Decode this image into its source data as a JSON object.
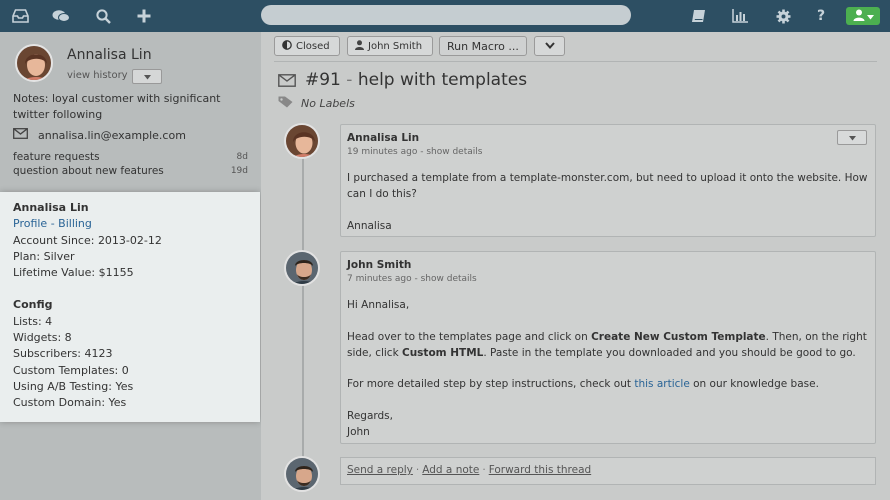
{
  "nav": {
    "icons": [
      "inbox-icon",
      "chat-icon",
      "search-icon",
      "plus-icon",
      "book-icon",
      "bar-chart-icon",
      "gear-icon",
      "help-icon",
      "user-icon"
    ]
  },
  "customer": {
    "name": "Annalisa Lin",
    "view_history": "view history",
    "notes": "Notes: loyal customer with significant twitter following",
    "email": "annalisa.lin@example.com",
    "conversations": [
      {
        "subject": "feature requests",
        "age": "8d"
      },
      {
        "subject": "question about new features",
        "age": "19d"
      }
    ]
  },
  "profile": {
    "name": "Annalisa Lin",
    "link": "Profile - Billing",
    "account_since": "Account Since: 2013-02-12",
    "plan": "Plan: Silver",
    "lifetime_value": "Lifetime Value: $1155",
    "config_heading": "Config",
    "config": [
      "Lists: 4",
      "Widgets: 8",
      "Subscribers: 4123",
      "Custom Templates: 0",
      "Using A/B Testing: Yes",
      "Custom Domain: Yes"
    ]
  },
  "toolbar": {
    "status": "Closed",
    "assignee": "John Smith",
    "macro": "Run Macro ..."
  },
  "ticket": {
    "number": "#91",
    "separator": " - ",
    "subject": "help with templates",
    "labels": "No Labels"
  },
  "messages": [
    {
      "author": "Annalisa Lin",
      "time": "19 minutes ago",
      "details": "show details",
      "body": [
        "I purchased a template from a template-monster.com, but need to upload it onto the website.  How can I do this?",
        "Annalisa"
      ]
    },
    {
      "author": "John Smith",
      "time": "7 minutes ago",
      "details": "show details",
      "greeting": "Hi Annalisa,",
      "p1_a": "Head over to the templates page and click on ",
      "p1_b": "Create New Custom Template",
      "p1_c": ". Then, on the right side, click ",
      "p1_d": "Custom HTML",
      "p1_e": ". Paste in the template you downloaded and you should be good to go.",
      "p2_a": "For more detailed step by step instructions, check out ",
      "p2_link": "this article",
      "p2_b": " on our knowledge base.",
      "signoff": "Regards,",
      "signature": "John"
    }
  ],
  "reply": {
    "send": "Send a reply",
    "note": "Add a note",
    "forward": "Forward this thread",
    "dot": "·"
  }
}
